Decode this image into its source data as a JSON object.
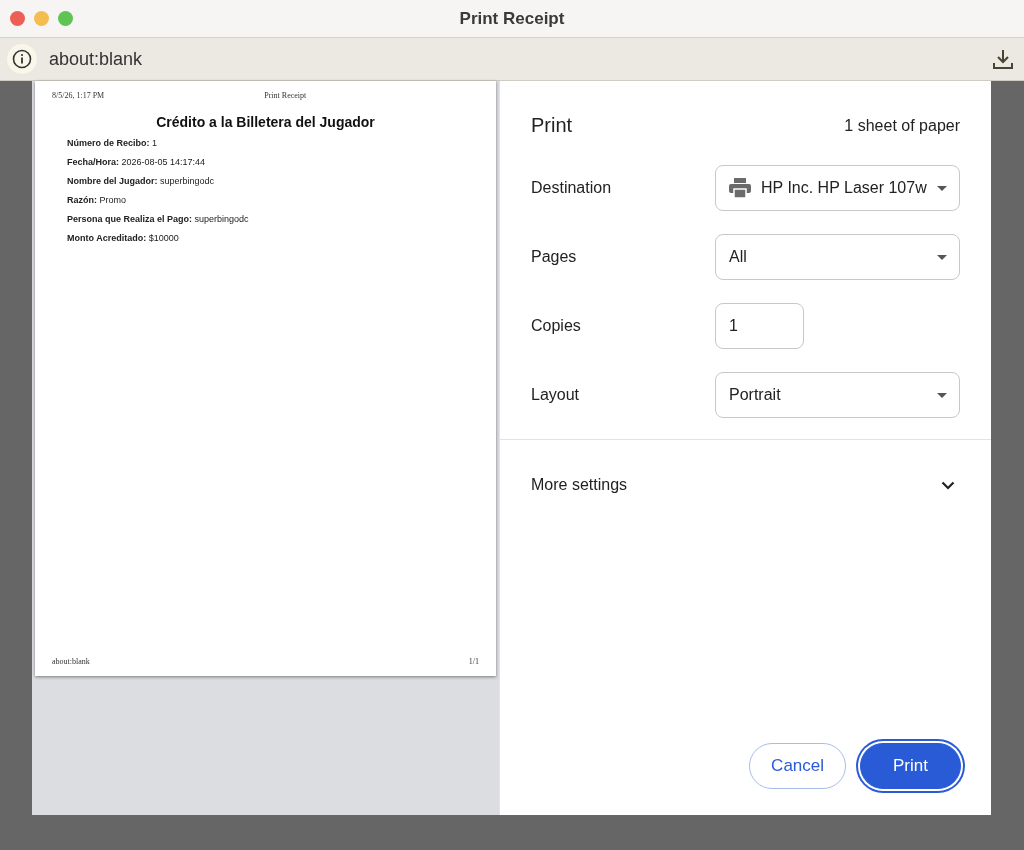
{
  "window": {
    "title": "Print Receipt"
  },
  "toolbar": {
    "address": "about:blank"
  },
  "preview": {
    "header_left": "8/5/26, 1:17 PM",
    "header_center": "Print Receipt",
    "heading": "Crédito a la Billetera del Jugador",
    "fields": [
      {
        "label": "Número de Recibo:",
        "value": "1"
      },
      {
        "label": "Fecha/Hora:",
        "value": "2026-08-05 14:17:44"
      },
      {
        "label": "Nombre del Jugador:",
        "value": "superbingodc"
      },
      {
        "label": "Razón:",
        "value": "Promo"
      },
      {
        "label": "Persona que Realiza el Pago:",
        "value": "superbingodc"
      },
      {
        "label": "Monto Acreditado:",
        "value": "$10000"
      }
    ],
    "footer_left": "about:blank",
    "footer_right": "1/1"
  },
  "print_panel": {
    "title": "Print",
    "sheet_count": "1 sheet of paper",
    "settings": [
      {
        "label": "Destination",
        "kind": "printer-select",
        "value": "HP Inc. HP Laser 107w"
      },
      {
        "label": "Pages",
        "kind": "select",
        "value": "All"
      },
      {
        "label": "Copies",
        "kind": "input",
        "value": "1"
      },
      {
        "label": "Layout",
        "kind": "select",
        "value": "Portrait"
      }
    ],
    "more_settings": {
      "label": "More settings",
      "expanded": false
    },
    "buttons": [
      {
        "label": "Cancel",
        "kind": "secondary"
      },
      {
        "label": "Print",
        "kind": "primary"
      }
    ]
  }
}
